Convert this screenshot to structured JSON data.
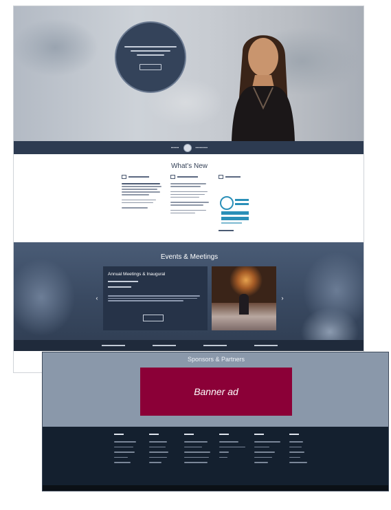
{
  "page": {
    "whats_new_title": "What's New",
    "events_title": "Events & Meetings",
    "event_card_title": "Annual Meetings & Inaugural",
    "arrow_left": "‹",
    "arrow_right": "›"
  },
  "sponsors": {
    "title": "Sponsors & Partners",
    "banner_label": "Banner ad"
  },
  "colors": {
    "navy": "#2d3b51",
    "banner": "#8b0037",
    "sponsors_bg": "#8a98aa",
    "footer_bg": "#14202f"
  }
}
